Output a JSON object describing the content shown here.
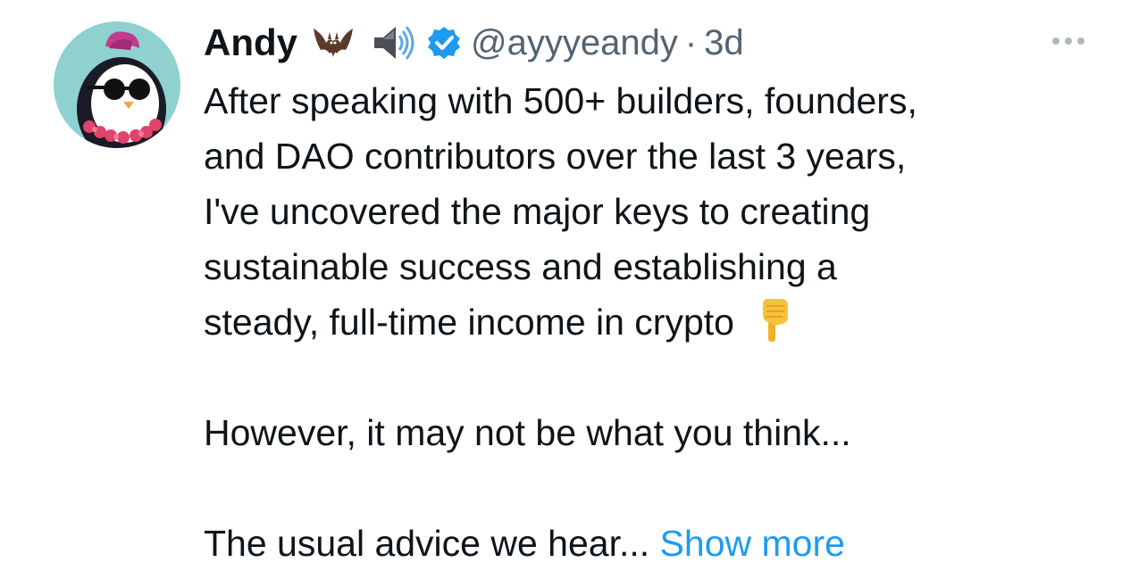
{
  "author": {
    "display_name": "Andy",
    "name_emojis": [
      "bat-icon",
      "speaker-icon"
    ],
    "handle": "@ayyyeandy",
    "separator": "·",
    "timestamp": "3d",
    "verified": true
  },
  "tweet": {
    "lines": [
      "After speaking with 500+ builders, founders,",
      "and DAO contributors over the last 3 years,",
      "I've uncovered the major keys to creating",
      "sustainable success and establishing a",
      "steady, full-time income in crypto"
    ],
    "line2": "However, it may not be what you think...",
    "line3": "The usual advice we hear...",
    "show_more_label": "Show more"
  },
  "colors": {
    "text": "#0f1419",
    "secondary": "#536471",
    "accent": "#1d9bf0",
    "avatar_bg": "#8fd1cf"
  }
}
